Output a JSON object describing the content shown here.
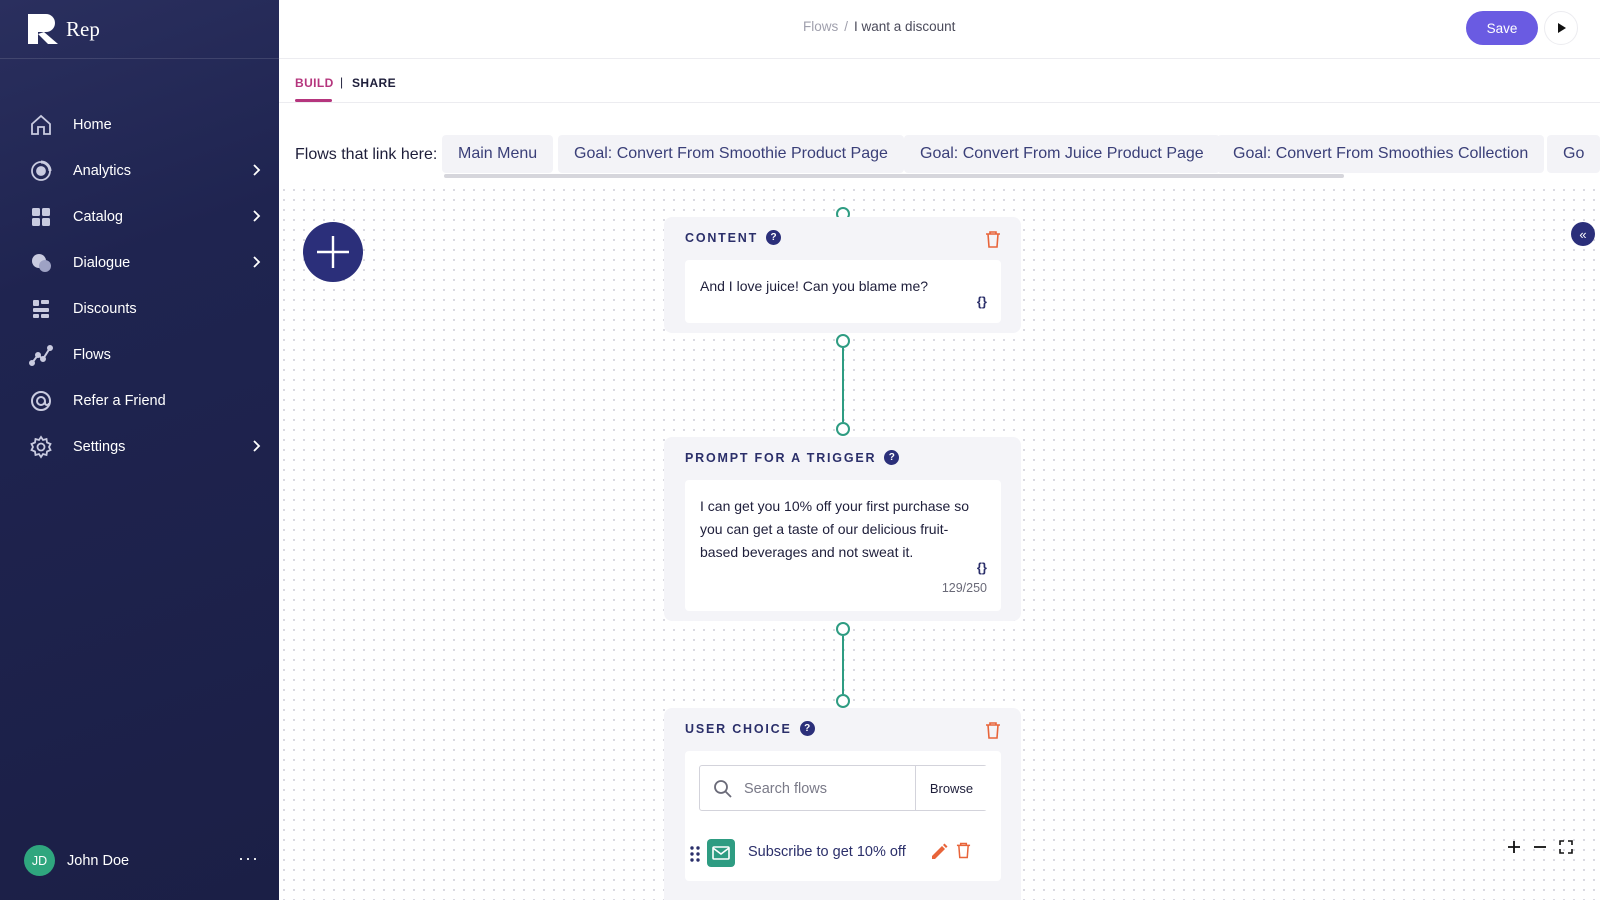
{
  "app": {
    "name": "Rep"
  },
  "sidebar": {
    "items": [
      {
        "label": "Home",
        "icon": "home-icon",
        "has_submenu": false
      },
      {
        "label": "Analytics",
        "icon": "analytics-icon",
        "has_submenu": true
      },
      {
        "label": "Catalog",
        "icon": "catalog-icon",
        "has_submenu": true
      },
      {
        "label": "Dialogue",
        "icon": "dialogue-icon",
        "has_submenu": true
      },
      {
        "label": "Discounts",
        "icon": "discounts-icon",
        "has_submenu": false
      },
      {
        "label": "Flows",
        "icon": "flows-icon",
        "has_submenu": false
      },
      {
        "label": "Refer a Friend",
        "icon": "refer-icon",
        "has_submenu": false
      },
      {
        "label": "Settings",
        "icon": "gear-icon",
        "has_submenu": true
      }
    ],
    "user": {
      "initials": "JD",
      "name": "John Doe",
      "more": "···"
    }
  },
  "header": {
    "breadcrumb_parent": "Flows",
    "breadcrumb_sep": "/",
    "breadcrumb_current": "I want a discount",
    "save_label": "Save"
  },
  "tabs": {
    "build": "BUILD",
    "separator": "|",
    "share": "SHARE",
    "active": "BUILD"
  },
  "linked_flows": {
    "label": "Flows that link here:",
    "chips": [
      "Main Menu",
      "Goal: Convert From Smoothie Product Page",
      "Goal: Convert From Juice Product Page",
      "Goal: Convert From Smoothies Collection",
      "Go"
    ]
  },
  "canvas": {
    "collapse_label": "«",
    "cards": {
      "content": {
        "title": "CONTENT",
        "help": "?",
        "message": "And I love juice! Can you blame me?",
        "braces": "{}"
      },
      "prompt": {
        "title": "PROMPT FOR A TRIGGER",
        "help": "?",
        "message": "I can get you 10% off your first purchase so you can get a taste of our delicious fruit-based beverages and not sweat it.",
        "braces": "{}",
        "counter": "129/250"
      },
      "user_choice": {
        "title": "USER CHOICE",
        "help": "?",
        "search_placeholder": "Search flows",
        "browse_label": "Browse",
        "choice_label": "Subscribe to get 10% off"
      }
    }
  },
  "colors": {
    "sidebar_bg": "#1f2450",
    "accent_primary": "#6a5be2",
    "tab_active": "#b5357d",
    "connector": "#2e9c82",
    "trash": "#e8643a",
    "navy": "#2b2f7a"
  }
}
